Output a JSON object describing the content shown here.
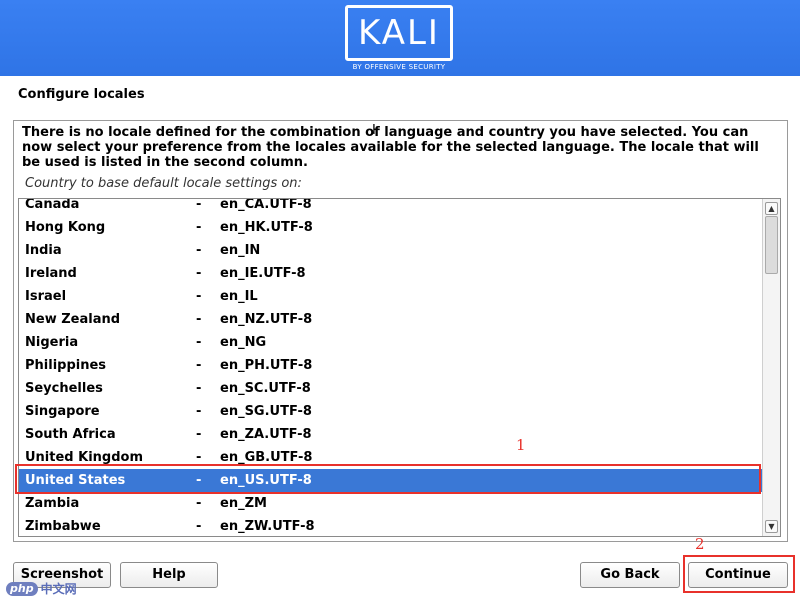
{
  "branding": {
    "logo_text": "KALI",
    "logo_subtext": "BY OFFENSIVE SECURITY"
  },
  "page": {
    "title": "Configure locales",
    "description": "There is no locale defined for the combination of language and country you have selected. You can now select your preference from the locales available for the selected language. The locale that will be used is listed in the second column.",
    "list_label": "Country to base default locale settings on:"
  },
  "locales": [
    {
      "country": "Canada",
      "dash": "-",
      "locale": "en_CA.UTF-8"
    },
    {
      "country": "Hong Kong",
      "dash": "-",
      "locale": "en_HK.UTF-8"
    },
    {
      "country": "India",
      "dash": "-",
      "locale": "en_IN"
    },
    {
      "country": "Ireland",
      "dash": "-",
      "locale": "en_IE.UTF-8"
    },
    {
      "country": "Israel",
      "dash": "-",
      "locale": "en_IL"
    },
    {
      "country": "New Zealand",
      "dash": "-",
      "locale": "en_NZ.UTF-8"
    },
    {
      "country": "Nigeria",
      "dash": "-",
      "locale": "en_NG"
    },
    {
      "country": "Philippines",
      "dash": "-",
      "locale": "en_PH.UTF-8"
    },
    {
      "country": "Seychelles",
      "dash": "-",
      "locale": "en_SC.UTF-8"
    },
    {
      "country": "Singapore",
      "dash": "-",
      "locale": "en_SG.UTF-8"
    },
    {
      "country": "South Africa",
      "dash": "-",
      "locale": "en_ZA.UTF-8"
    },
    {
      "country": "United Kingdom",
      "dash": "-",
      "locale": "en_GB.UTF-8"
    },
    {
      "country": "United States",
      "dash": "-",
      "locale": "en_US.UTF-8"
    },
    {
      "country": "Zambia",
      "dash": "-",
      "locale": "en_ZM"
    },
    {
      "country": "Zimbabwe",
      "dash": "-",
      "locale": "en_ZW.UTF-8"
    }
  ],
  "selected_country": "United States",
  "annotations": {
    "step1": "1",
    "step2": "2"
  },
  "buttons": {
    "screenshot": "Screenshot",
    "help": "Help",
    "go_back": "Go Back",
    "continue": "Continue"
  },
  "watermark": {
    "logo": "php",
    "text": "中文网"
  },
  "colors": {
    "banner": "#367bf0",
    "selection": "#3a78d6",
    "annotation": "#e8312b"
  },
  "icons": {
    "cursor": "text-cursor-icon",
    "scroll_up": "chevron-up-icon",
    "scroll_down": "chevron-down-icon"
  }
}
